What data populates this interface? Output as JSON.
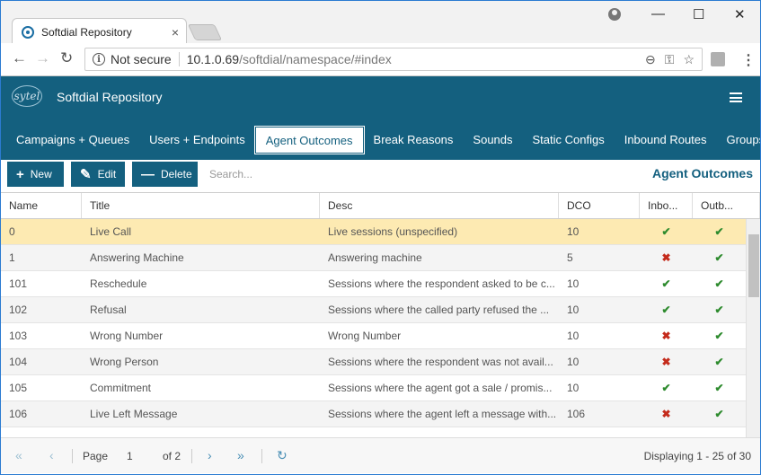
{
  "browser": {
    "tab_title": "Softdial Repository",
    "security_label": "Not secure",
    "url_host": "10.1.0.69",
    "url_path": "/softdial/namespace/#index",
    "tab_close": "×",
    "win_minimize": "—",
    "win_maximize": "☐",
    "win_close": "✕"
  },
  "app": {
    "logo_text": "sytel",
    "title": "Softdial Repository",
    "nav_tabs": [
      "Campaigns + Queues",
      "Users + Endpoints",
      "Agent Outcomes",
      "Break Reasons",
      "Sounds",
      "Static Configs",
      "Inbound Routes",
      "Groups"
    ],
    "active_tab": "Agent Outcomes"
  },
  "toolbar": {
    "new_label": "New",
    "edit_label": "Edit",
    "delete_label": "Delete",
    "search_placeholder": "Search...",
    "section_title": "Agent Outcomes"
  },
  "table": {
    "columns": [
      "Name",
      "Title",
      "Desc",
      "DCO",
      "Inbo...",
      "Outb..."
    ],
    "rows": [
      {
        "name": "0",
        "title": "Live Call",
        "desc": "Live sessions (unspecified)",
        "dco": "10",
        "inbound": true,
        "outbound": true
      },
      {
        "name": "1",
        "title": "Answering Machine",
        "desc": "Answering machine",
        "dco": "5",
        "inbound": false,
        "outbound": true
      },
      {
        "name": "101",
        "title": "Reschedule",
        "desc": "Sessions where the respondent asked to be c...",
        "dco": "10",
        "inbound": true,
        "outbound": true
      },
      {
        "name": "102",
        "title": "Refusal",
        "desc": "Sessions where the called party refused the ...",
        "dco": "10",
        "inbound": true,
        "outbound": true
      },
      {
        "name": "103",
        "title": "Wrong Number",
        "desc": "Wrong Number",
        "dco": "10",
        "inbound": false,
        "outbound": true
      },
      {
        "name": "104",
        "title": "Wrong Person",
        "desc": "Sessions where the respondent was not avail...",
        "dco": "10",
        "inbound": false,
        "outbound": true
      },
      {
        "name": "105",
        "title": "Commitment",
        "desc": "Sessions where the agent got a sale / promis...",
        "dco": "10",
        "inbound": true,
        "outbound": true
      },
      {
        "name": "106",
        "title": "Live Left Message",
        "desc": "Sessions where the agent left a message with...",
        "dco": "106",
        "inbound": false,
        "outbound": true
      }
    ],
    "selected_row": 0
  },
  "pager": {
    "page_label": "Page",
    "page_value": "1",
    "of_label": "of 2",
    "display_text": "Displaying 1 - 25 of 30"
  },
  "colors": {
    "brand": "#14607f",
    "selected_row": "#fdeab2",
    "check": "#2e8b2e",
    "cross": "#c42b1c"
  },
  "icons": {
    "check": "✔",
    "cross": "✖"
  }
}
